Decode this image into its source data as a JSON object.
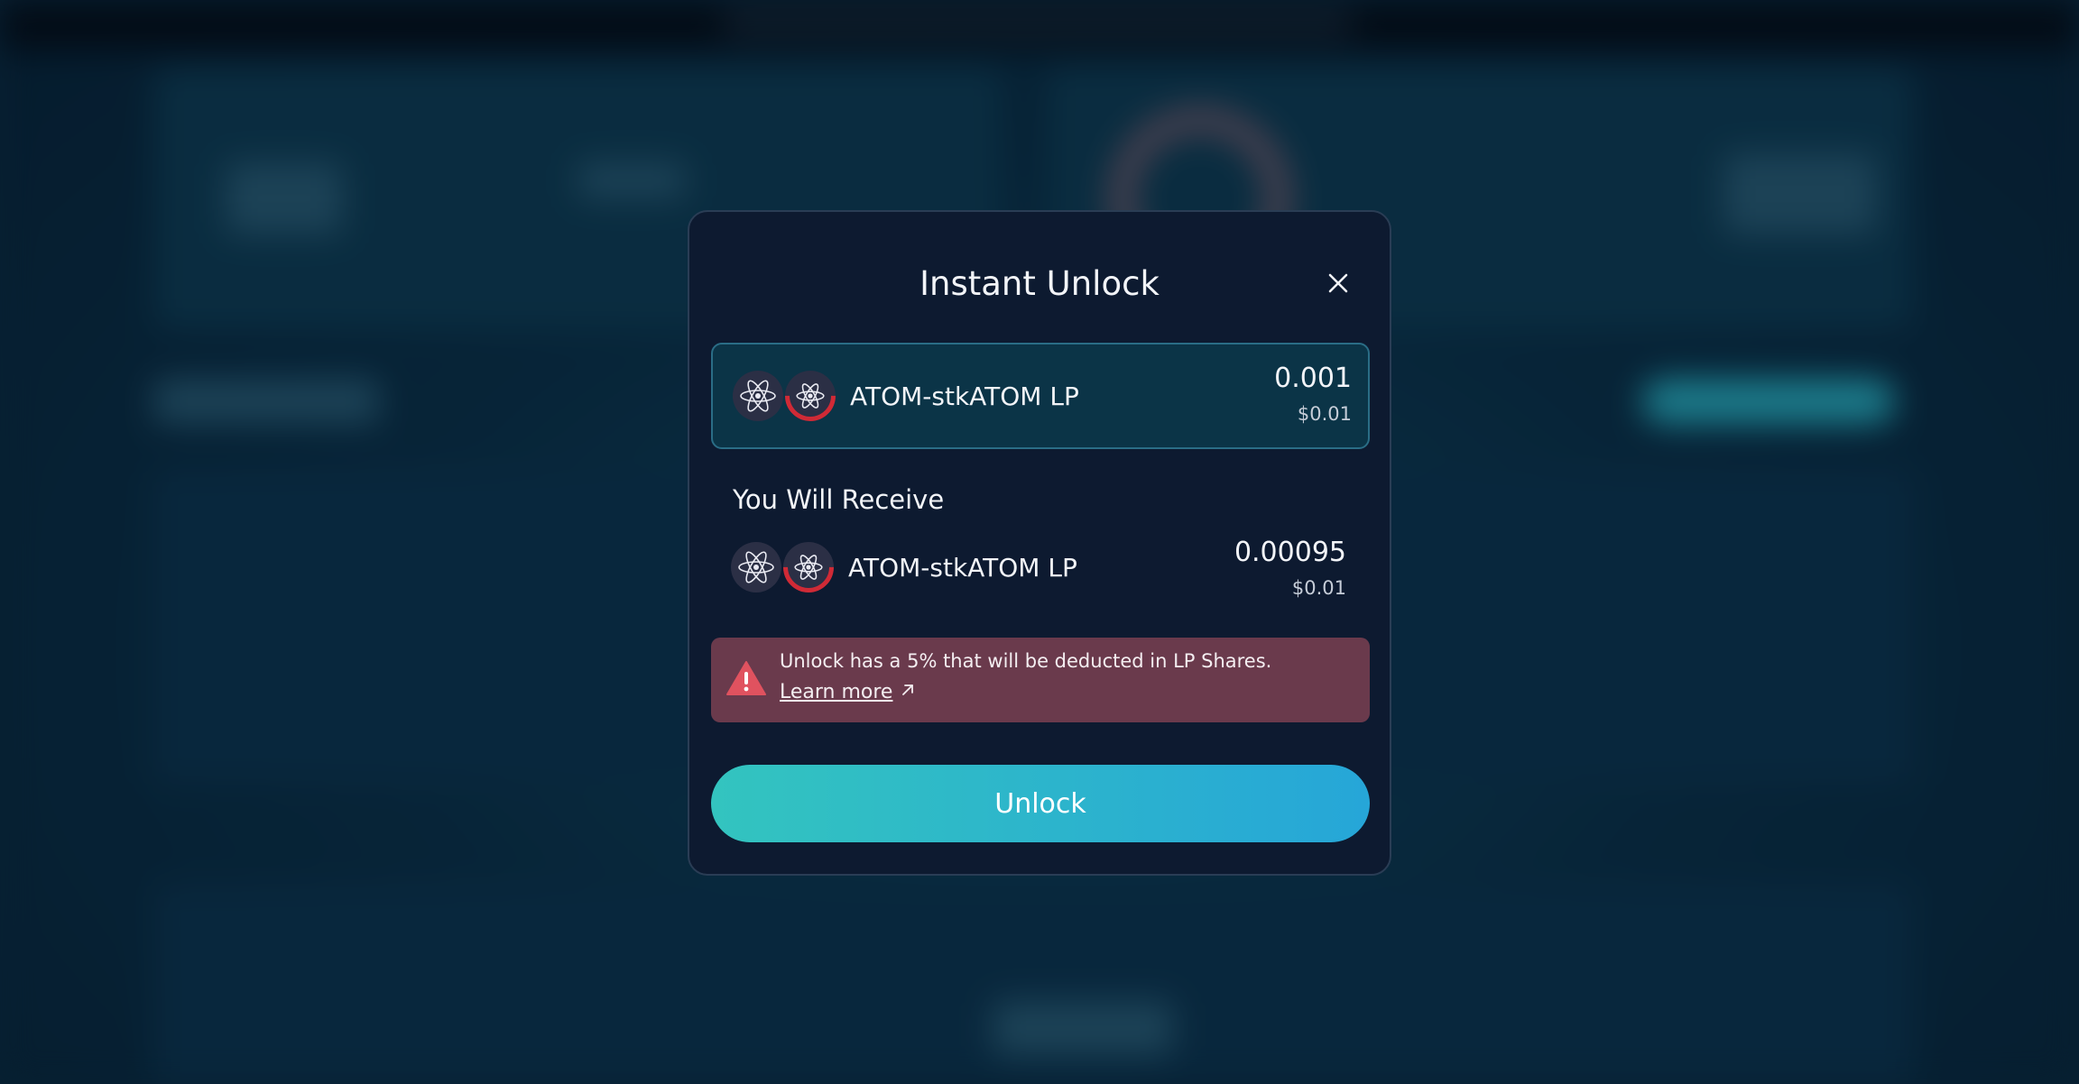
{
  "modal": {
    "title": "Instant Unlock",
    "close_icon": "close-icon"
  },
  "input": {
    "token_name": "ATOM-stkATOM LP",
    "amount": "0.001",
    "usd_value": "$0.01",
    "token_icons": [
      "atom-icon",
      "stkatom-icon"
    ]
  },
  "receive": {
    "label": "You Will Receive",
    "token_name": "ATOM-stkATOM LP",
    "amount": "0.00095",
    "usd_value": "$0.01",
    "token_icons": [
      "atom-icon",
      "stkatom-icon"
    ]
  },
  "warning": {
    "icon": "warning-icon",
    "message": "Unlock has a 5% that will be deducted in LP Shares.",
    "link_label": "Learn more",
    "link_icon": "external-link-icon",
    "background_color": "#6a3a4c"
  },
  "actions": {
    "unlock_label": "Unlock",
    "gradient_start": "#33c4bf",
    "gradient_end": "#26a6d8"
  }
}
